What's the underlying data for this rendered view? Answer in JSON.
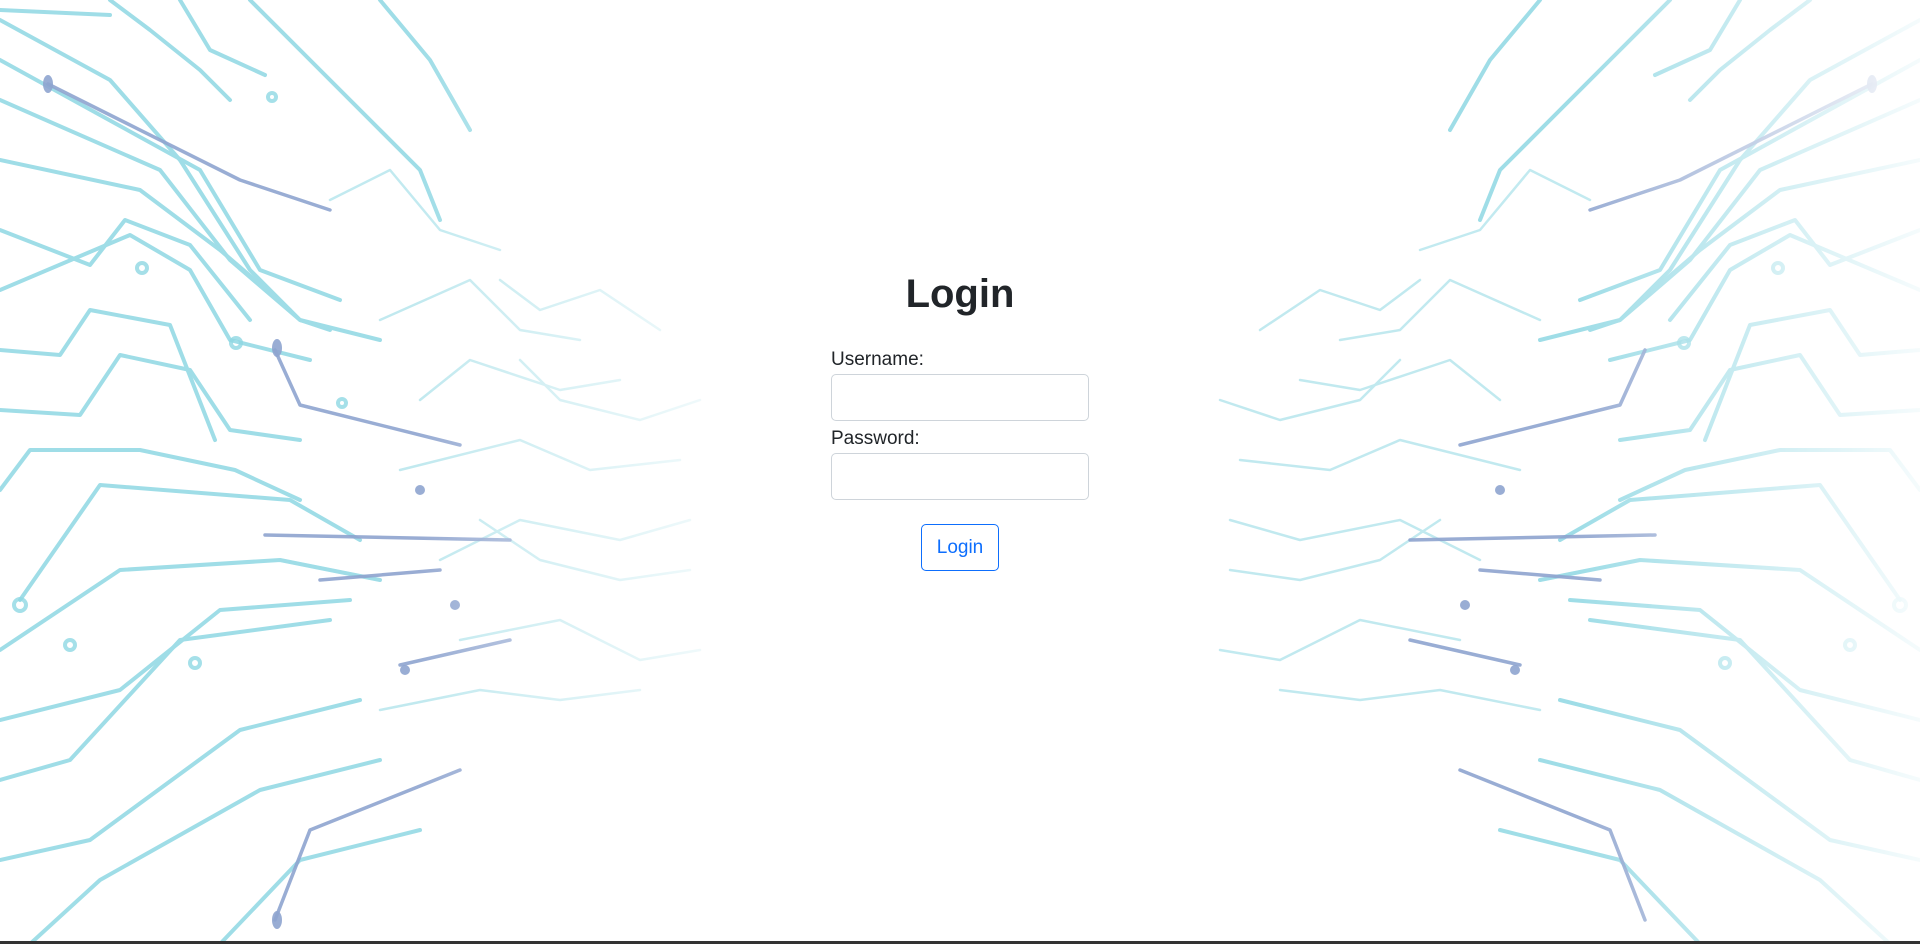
{
  "login": {
    "title": "Login",
    "username_label": "Username:",
    "username_value": "",
    "password_label": "Password:",
    "password_value": "",
    "submit_label": "Login"
  },
  "colors": {
    "circuit_primary": "#8fd8e3",
    "circuit_secondary": "#8ea4cf",
    "button_accent": "#0d6efd",
    "title_text": "#212529"
  },
  "decor": {
    "background_icon": "circuit-board-pattern"
  }
}
